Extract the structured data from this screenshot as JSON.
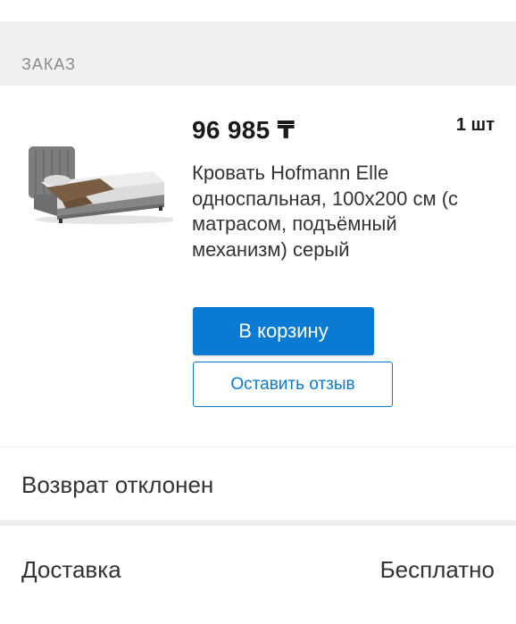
{
  "section": {
    "title": "ЗАКАЗ"
  },
  "item": {
    "price": "96 985 ₸",
    "quantity": "1 шт",
    "title": "Кровать Hofmann Elle односпальная, 100x200 см (с матрасом, подъёмный механизм) серый",
    "cart_button": "В корзину",
    "review_button": "Оставить отзыв"
  },
  "return_status": "Возврат отклонен",
  "delivery": {
    "label": "Доставка",
    "value": "Бесплатно"
  },
  "colors": {
    "accent": "#0a7ad2",
    "muted": "#8a8a8a"
  }
}
